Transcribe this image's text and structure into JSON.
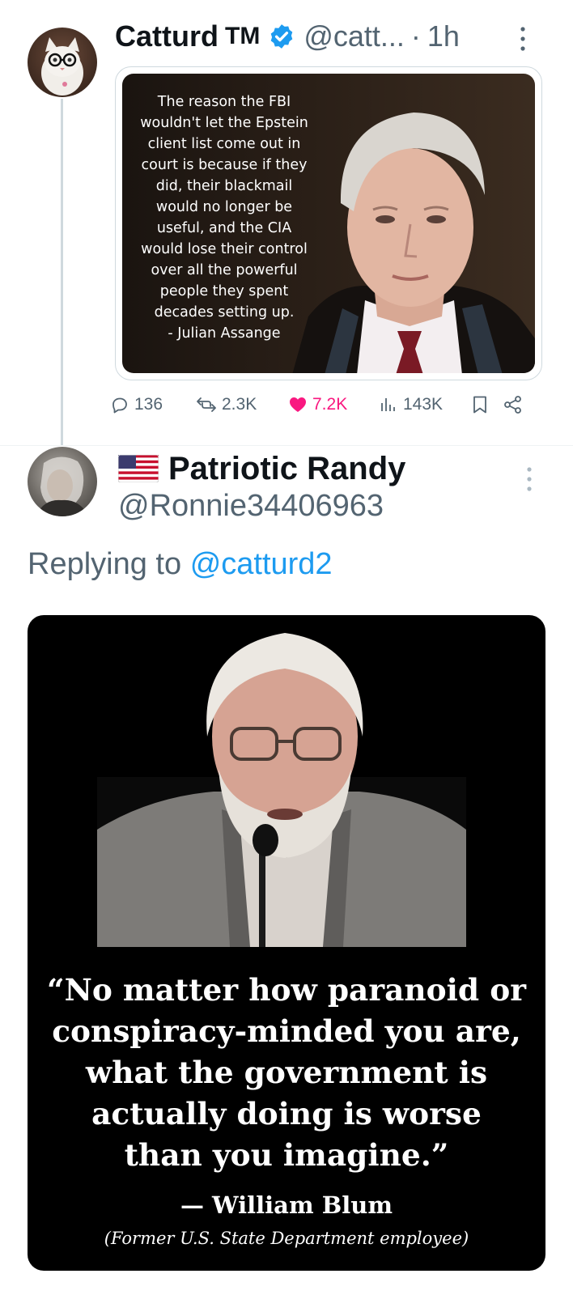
{
  "tweet1": {
    "author_name": "Catturd",
    "trademark": "TM",
    "handle": "@catt...",
    "separator": "·",
    "time": "1h",
    "media": {
      "quote_lines": [
        "The reason the FBI",
        "wouldn't let the Epstein",
        "client list come out in",
        "court is because if they",
        "did, their blackmail",
        "would no longer be",
        "useful, and the CIA",
        "would lose their control",
        "over all the powerful",
        "people they spent",
        "decades setting up.",
        "- Julian Assange"
      ]
    },
    "actions": {
      "replies": "136",
      "reposts": "2.3K",
      "likes": "7.2K",
      "views": "143K"
    },
    "colors": {
      "like": "#f91880",
      "verified": "#1d9bf0",
      "muted": "#536471"
    }
  },
  "tweet2": {
    "author_name": "Patriotic Randy",
    "handle": "@Ronnie34406963",
    "replying_prefix": "Replying to",
    "replying_mention": "@catturd2",
    "media": {
      "quote_lines": [
        "“No matter how paranoid or",
        "conspiracy-minded you are,",
        "what the government is",
        "actually doing is worse",
        "than you imagine.”"
      ],
      "attribution": "— William Blum",
      "role": "(Former U.S. State Department employee)"
    },
    "colors": {
      "mention": "#1d9bf0"
    }
  }
}
